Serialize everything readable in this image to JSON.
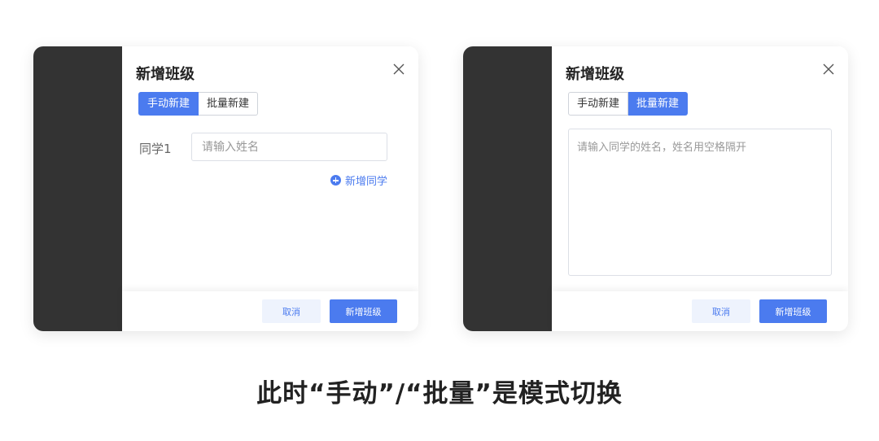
{
  "left_panel": {
    "title": "新增班级",
    "tabs": [
      "手动新建",
      "批量新建"
    ],
    "active_tab": "手动新建",
    "student_label": "同学1",
    "name_placeholder": "请输入姓名",
    "add_student_label": "新增同学",
    "cancel_label": "取消",
    "submit_label": "新增班级"
  },
  "right_panel": {
    "title": "新增班级",
    "tabs": [
      "手动新建",
      "批量新建"
    ],
    "active_tab": "批量新建",
    "textarea_placeholder": "请输入同学的姓名，姓名用空格隔开",
    "cancel_label": "取消",
    "submit_label": "新增班级"
  },
  "caption": "此时“手动”/“批量”是模式切换",
  "colors": {
    "accent": "#4b7bef",
    "sidebar_dark": "#333333",
    "cancel_bg": "#eef3fd"
  }
}
